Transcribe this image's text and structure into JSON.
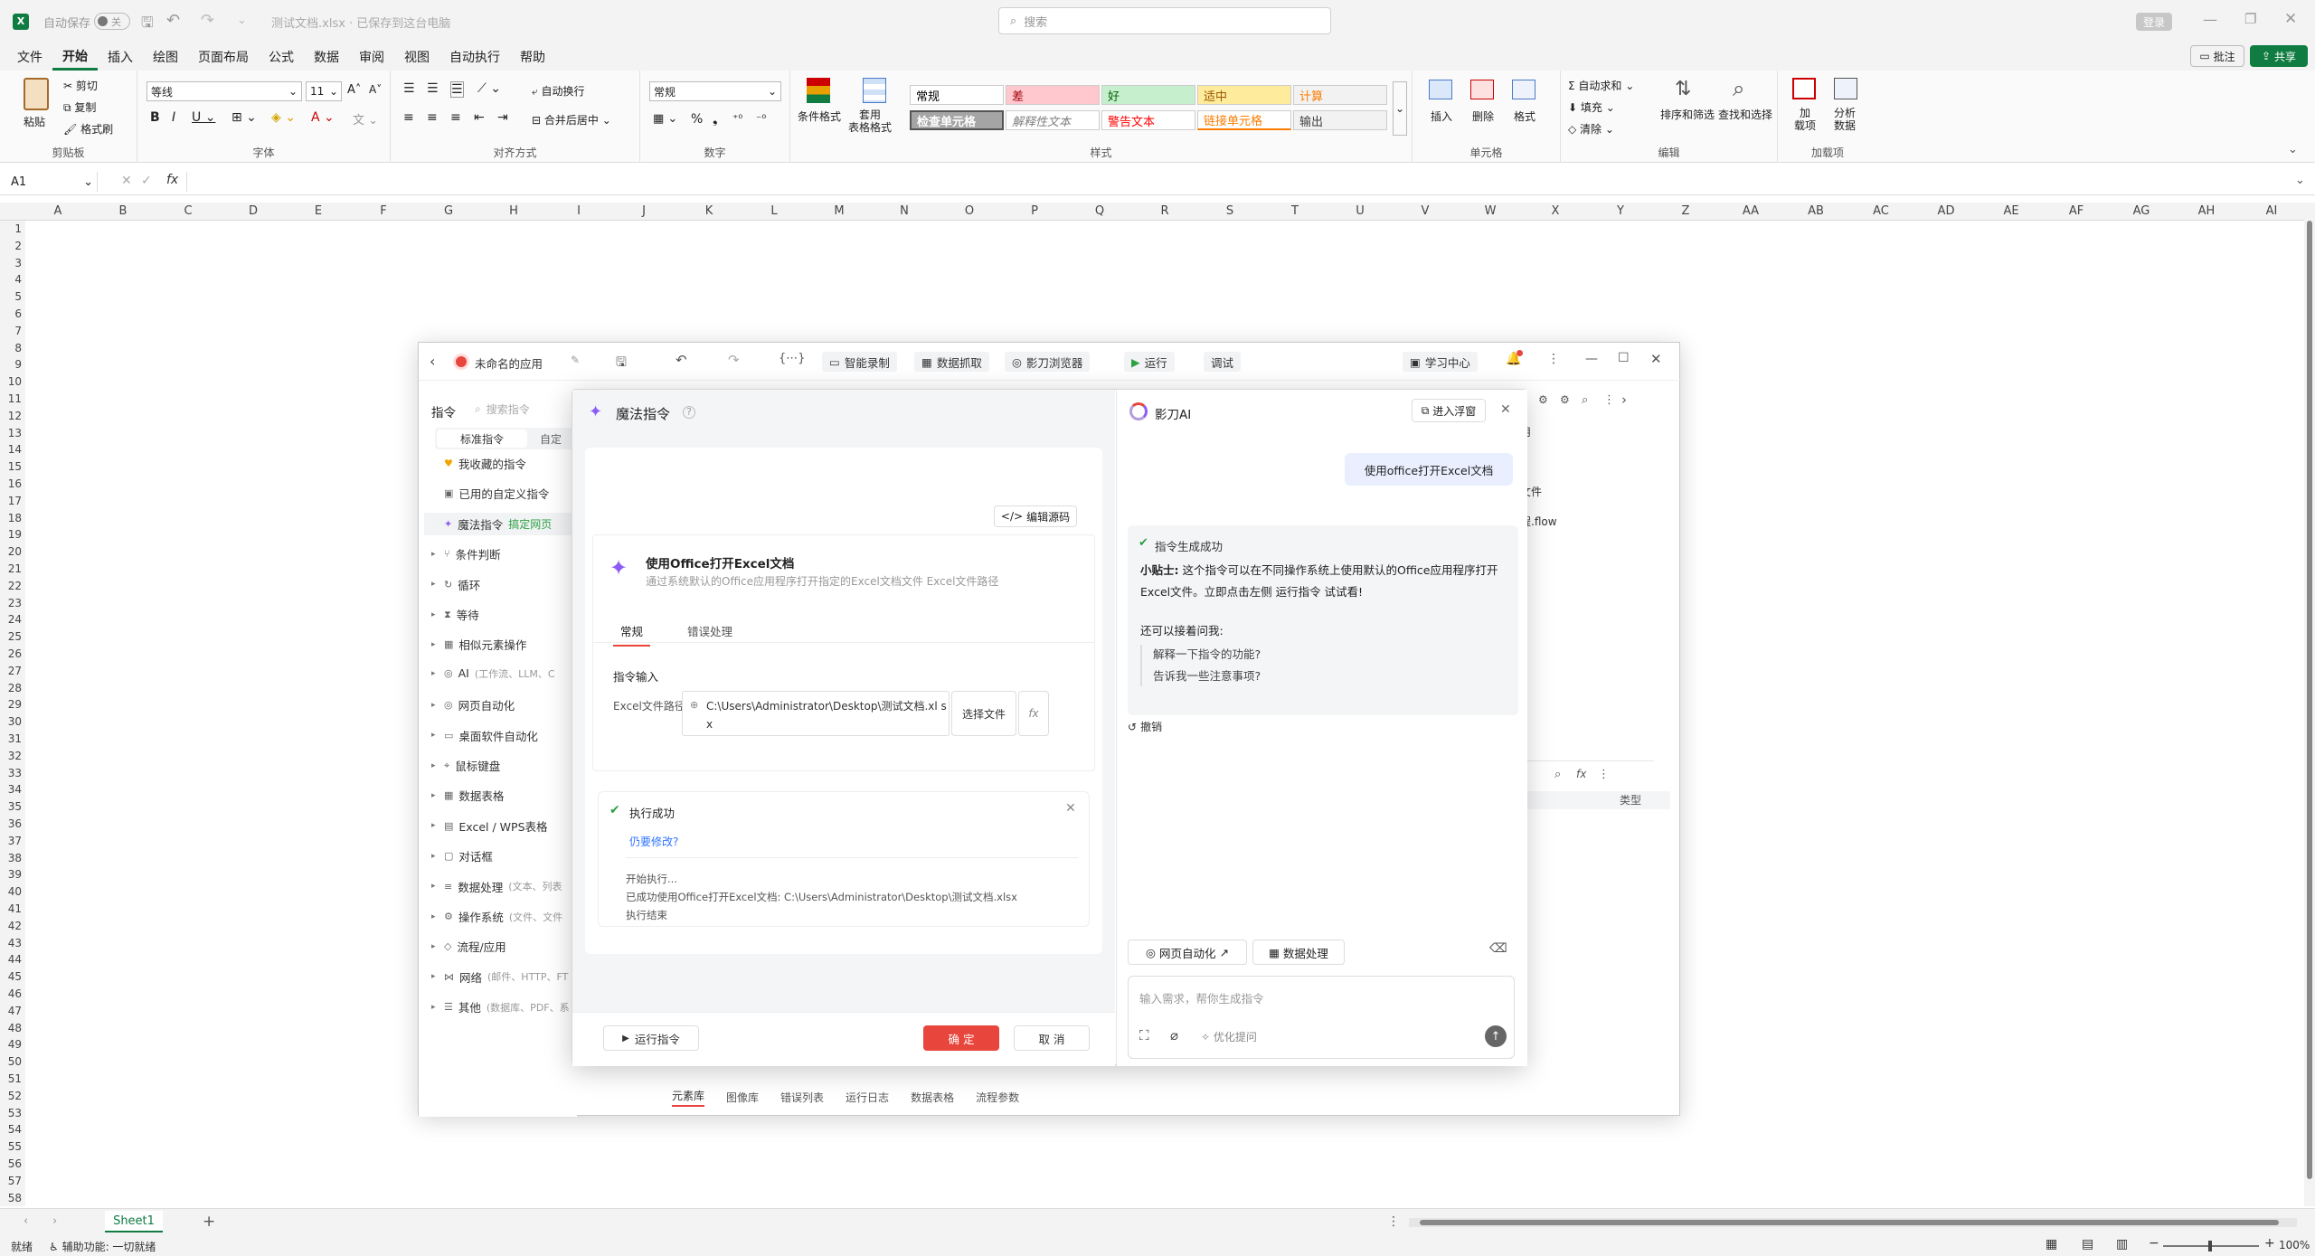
{
  "excel": {
    "autosave_label": "自动保存",
    "autosave_state": "关",
    "file_title": "测试文档.xlsx · 已保存到这台电脑",
    "search_placeholder": "搜索",
    "login_label": "登录",
    "tabs": [
      "文件",
      "开始",
      "插入",
      "绘图",
      "页面布局",
      "公式",
      "数据",
      "审阅",
      "视图",
      "自动执行",
      "帮助"
    ],
    "comment_btn": "批注",
    "share_btn": "共享",
    "clipboard": {
      "paste": "粘贴",
      "cut": "剪切",
      "copy": "复制",
      "format_painter": "格式刷",
      "label": "剪贴板"
    },
    "font": {
      "name": "等线",
      "size": "11",
      "label": "字体"
    },
    "align": {
      "wrap": "自动换行",
      "merge": "合并后居中",
      "label": "对齐方式"
    },
    "number": {
      "format": "常规",
      "label": "数字"
    },
    "styles": {
      "cond_format": "条件格式",
      "table_format": "套用\n表格格式",
      "cells": [
        {
          "text": "常规",
          "bg": "#ffffff",
          "color": "#000000"
        },
        {
          "text": "差",
          "bg": "#ffc7ce",
          "color": "#9c0006"
        },
        {
          "text": "好",
          "bg": "#c6efce",
          "color": "#006100"
        },
        {
          "text": "适中",
          "bg": "#ffeb9c",
          "color": "#9c5700"
        },
        {
          "text": "计算",
          "bg": "#f2f2f2",
          "color": "#fa7d00"
        },
        {
          "text": "检查单元格",
          "bg": "#a5a5a5",
          "color": "#ffffff"
        },
        {
          "text": "解释性文本",
          "bg": "#ffffff",
          "color": "#7f7f7f"
        },
        {
          "text": "警告文本",
          "bg": "#ffffff",
          "color": "#ff0000"
        },
        {
          "text": "链接单元格",
          "bg": "#ffffff",
          "color": "#fa7d00"
        },
        {
          "text": "输出",
          "bg": "#f2f2f2",
          "color": "#3f3f3f"
        }
      ],
      "label": "样式"
    },
    "cells_group": {
      "insert": "插入",
      "delete": "删除",
      "format": "格式",
      "label": "单元格"
    },
    "edit_group": {
      "autosum": "自动求和",
      "fill": "填充",
      "clear": "清除",
      "sort": "排序和筛选",
      "find": "查找和选择",
      "label": "编辑"
    },
    "addins": {
      "addin": "加\n载项",
      "analyze": "分析\n数据",
      "label": "加载项"
    },
    "name_box": "A1",
    "fx": "fx",
    "columns": [
      "A",
      "B",
      "C",
      "D",
      "E",
      "F",
      "G",
      "H",
      "I",
      "J",
      "K",
      "L",
      "M",
      "N",
      "O",
      "P",
      "Q",
      "R",
      "S",
      "T",
      "U",
      "V",
      "W",
      "X",
      "Y",
      "Z",
      "AA",
      "AB",
      "AC",
      "AD",
      "AE",
      "AF",
      "AG",
      "AH",
      "AI"
    ],
    "row_count": 58,
    "sheet_name": "Sheet1",
    "status_ready": "就绪",
    "status_accessibility": "辅助功能: 一切就绪",
    "zoom": "100%"
  },
  "rpa": {
    "app_name": "未命名的应用",
    "toolbar": {
      "record": "智能录制",
      "grab": "数据抓取",
      "browser": "影刀浏览器",
      "run": "运行",
      "debug": "调试",
      "learn": "学习中心"
    },
    "panel_title": "指令",
    "search_placeholder": "搜索指令",
    "tab_standard": "标准指令",
    "tab_custom": "自定",
    "commands": [
      {
        "label": "我收藏的指令",
        "sub": "",
        "arrow": false,
        "icon": "heart"
      },
      {
        "label": "已用的自定义指令",
        "sub": "",
        "arrow": false,
        "icon": "box"
      },
      {
        "label": "魔法指令",
        "sub": "搞定网页",
        "arrow": false,
        "icon": "sparkle"
      },
      {
        "label": "条件判断",
        "sub": "",
        "arrow": true,
        "icon": "branch"
      },
      {
        "label": "循环",
        "sub": "",
        "arrow": true,
        "icon": "loop"
      },
      {
        "label": "等待",
        "sub": "",
        "arrow": true,
        "icon": "hourglass"
      },
      {
        "label": "相似元素操作",
        "sub": "",
        "arrow": true,
        "icon": "grid"
      },
      {
        "label": "AI",
        "sub": "(工作流、LLM、C",
        "arrow": true,
        "icon": "ai"
      },
      {
        "label": "网页自动化",
        "sub": "",
        "arrow": true,
        "icon": "globe"
      },
      {
        "label": "桌面软件自动化",
        "sub": "",
        "arrow": true,
        "icon": "monitor"
      },
      {
        "label": "鼠标键盘",
        "sub": "",
        "arrow": true,
        "icon": "mouse"
      },
      {
        "label": "数据表格",
        "sub": "",
        "arrow": true,
        "icon": "table"
      },
      {
        "label": "Excel / WPS表格",
        "sub": "",
        "arrow": true,
        "icon": "excel"
      },
      {
        "label": "对话框",
        "sub": "",
        "arrow": true,
        "icon": "dialog"
      },
      {
        "label": "数据处理",
        "sub": "(文本、列表",
        "arrow": true,
        "icon": "data"
      },
      {
        "label": "操作系统",
        "sub": "(文件、文件",
        "arrow": true,
        "icon": "os"
      },
      {
        "label": "流程/应用",
        "sub": "",
        "arrow": true,
        "icon": "flow"
      },
      {
        "label": "网络",
        "sub": "(邮件、HTTP、FT",
        "arrow": true,
        "icon": "net"
      },
      {
        "label": "其他",
        "sub": "(数据库、PDF、系",
        "arrow": true,
        "icon": "other"
      }
    ],
    "right_items": [
      "应用",
      "用",
      "源文件",
      "流程.flow"
    ],
    "right_col_header": "类型",
    "bottom_tabs": [
      "元素库",
      "图像库",
      "错误列表",
      "运行日志",
      "数据表格",
      "流程参数"
    ]
  },
  "magic": {
    "title": "魔法指令",
    "edit_source": "编辑源码",
    "cmd_title": "使用Office打开Excel文档",
    "cmd_desc": "通过系统默认的Office应用程序打开指定的Excel文档文件 Excel文件路径",
    "tabs": [
      "常规",
      "错误处理"
    ],
    "section_input": "指令输入",
    "field_label": "Excel文件路径:",
    "field_value": "C:\\Users\\Administrator\\Desktop\\测试文档.xl sx",
    "choose_file": "选择文件",
    "fx": "fx",
    "exec_title": "执行成功",
    "modify_link": "仍要修改?",
    "log": [
      "开始执行...",
      "已成功使用Office打开Excel文档: C:\\Users\\Administrator\\Desktop\\测试文档.xlsx",
      "执行结束"
    ],
    "run_btn": "运行指令",
    "ok_btn": "确 定",
    "cancel_btn": "取 消",
    "ai_title": "影刀AI",
    "float_btn": "进入浮窗",
    "user_msg": "使用office打开Excel文档",
    "gen_success": "指令生成成功",
    "tip_label": "小贴士:",
    "tip_text": "这个指令可以在不同操作系统上使用默认的Office应用程序打开Excel文件。立即点击左侧 运行指令 试试看!",
    "ask_label": "还可以接着问我:",
    "suggestions": [
      "解释一下指令的功能?",
      "告诉我一些注意事项?"
    ],
    "undo": "撤销",
    "chip_web": "网页自动化",
    "chip_data": "数据处理",
    "input_placeholder": "输入需求，帮你生成指令",
    "optimize": "优化提问",
    "accent": "#e8453c"
  }
}
